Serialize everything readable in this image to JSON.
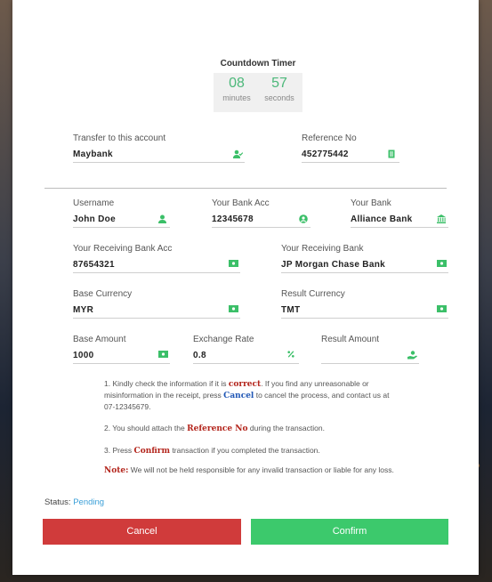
{
  "timer": {
    "title": "Countdown Timer",
    "minutes": "08",
    "minutes_label": "minutes",
    "seconds": "57",
    "seconds_label": "seconds"
  },
  "transfer": {
    "label": "Transfer to this account",
    "value": "Maybank",
    "icon": "user-check-icon"
  },
  "reference": {
    "label": "Reference No",
    "value": "452775442",
    "icon": "receipt-icon"
  },
  "username": {
    "label": "Username",
    "value": "John Doe",
    "icon": "user-icon"
  },
  "your_bank_acc": {
    "label": "Your Bank Acc",
    "value": "12345678",
    "icon": "user-circle-icon"
  },
  "your_bank": {
    "label": "Your Bank",
    "value": "Alliance Bank",
    "icon": "bank-icon"
  },
  "receiving_acc": {
    "label": "Your Receiving Bank Acc",
    "value": "87654321",
    "icon": "money-icon"
  },
  "receiving_bank": {
    "label": "Your Receiving Bank",
    "value": "JP Morgan Chase Bank",
    "icon": "money-icon"
  },
  "base_currency": {
    "label": "Base Currency",
    "value": "MYR",
    "icon": "money-icon"
  },
  "result_currency": {
    "label": "Result Currency",
    "value": "TMT",
    "icon": "money-icon"
  },
  "base_amount": {
    "label": "Base Amount",
    "value": "1000",
    "icon": "money-icon"
  },
  "exchange_rate": {
    "label": "Exchange Rate",
    "value": "0.8",
    "icon": "percent-icon"
  },
  "result_amount": {
    "label": "Result Amount",
    "value": "",
    "icon": "hand-coin-icon"
  },
  "notes": {
    "n1_a": "1. Kindly check the information if it is ",
    "n1_hl": "correct",
    "n1_b": ". If you find any unreasonable or misinformation in the receipt, press ",
    "n1_cancel": "Cancel",
    "n1_c": " to cancel the process, and contact us at 07-12345679.",
    "n2_a": "2. You should attach the ",
    "n2_hl": "Reference No",
    "n2_b": " during the transaction.",
    "n3_a": "3. Press ",
    "n3_hl": "Confirm",
    "n3_b": " transaction if you completed the transaction.",
    "n4_hl": "Note:",
    "n4_b": " We will not be held responsible for any invalid transaction or liable for any loss."
  },
  "status": {
    "label": "Status: ",
    "value": "Pending"
  },
  "buttons": {
    "cancel": "Cancel",
    "confirm": "Confirm"
  },
  "colors": {
    "accent": "#3cc96c",
    "danger": "#d03b3b",
    "pending": "#3a9fd8",
    "highlight": "#b3241b"
  }
}
